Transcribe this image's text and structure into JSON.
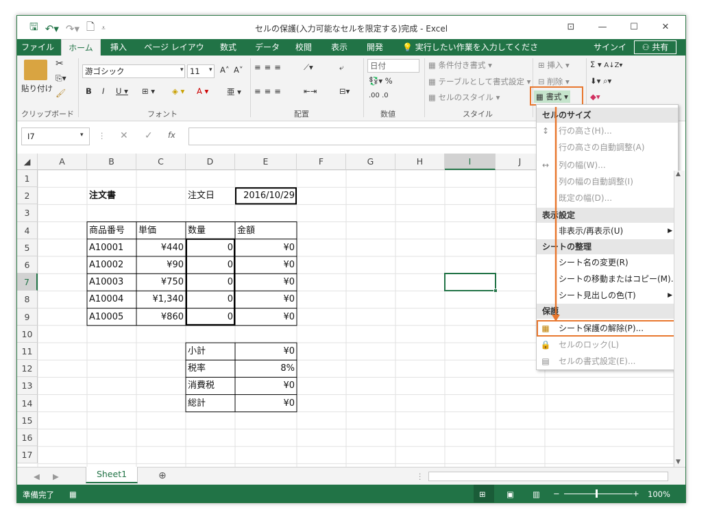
{
  "window": {
    "title": "セルの保護(入力可能なセルを限定する)完成 - Excel"
  },
  "quick_access": {
    "save_icon": "save-icon",
    "undo_icon": "undo-icon",
    "redo_icon": "redo-icon",
    "preview_icon": "print-preview-icon"
  },
  "tabs": [
    "ファイル",
    "ホーム",
    "挿入",
    "ページ レイアウト",
    "数式",
    "データ",
    "校閲",
    "表示",
    "開発"
  ],
  "tell_me": "実行したい作業を入力してください...",
  "signin": "サインイン",
  "share": "共有",
  "ribbon": {
    "clipboard": {
      "paste": "貼り付け",
      "label": "クリップボード"
    },
    "font": {
      "name": "游ゴシック",
      "size": "11",
      "label": "フォント"
    },
    "alignment": {
      "label": "配置"
    },
    "number": {
      "format": "日付",
      "label": "数値"
    },
    "styles": {
      "conditional": "条件付き書式",
      "table": "テーブルとして書式設定",
      "cell_styles": "セルのスタイル",
      "label": "スタイル"
    },
    "cells": {
      "insert": "挿入",
      "delete": "削除",
      "format": "書式"
    }
  },
  "name_box": "I7",
  "columns": [
    "A",
    "B",
    "C",
    "D",
    "E",
    "F",
    "G",
    "H",
    "I",
    "J"
  ],
  "rows": [
    "1",
    "2",
    "3",
    "4",
    "5",
    "6",
    "7",
    "8",
    "9",
    "10",
    "11",
    "12",
    "13",
    "14",
    "15",
    "16",
    "17"
  ],
  "sheet": {
    "title": "注文書",
    "order_date_label": "注文日",
    "order_date": "2016/10/29",
    "headers": {
      "product": "商品番号",
      "price": "単価",
      "qty": "数量",
      "amount": "金額"
    },
    "items": [
      {
        "product": "A10001",
        "price": "¥440",
        "qty": "0",
        "amount": "¥0"
      },
      {
        "product": "A10002",
        "price": "¥90",
        "qty": "0",
        "amount": "¥0"
      },
      {
        "product": "A10003",
        "price": "¥750",
        "qty": "0",
        "amount": "¥0"
      },
      {
        "product": "A10004",
        "price": "¥1,340",
        "qty": "0",
        "amount": "¥0"
      },
      {
        "product": "A10005",
        "price": "¥860",
        "qty": "0",
        "amount": "¥0"
      }
    ],
    "summary": [
      {
        "label": "小計",
        "value": "¥0"
      },
      {
        "label": "税率",
        "value": "8%"
      },
      {
        "label": "消費税",
        "value": "¥0"
      },
      {
        "label": "総計",
        "value": "¥0"
      }
    ]
  },
  "menu": {
    "section_size": "セルのサイズ",
    "row_height": "行の高さ(H)...",
    "row_autofit": "行の高さの自動調整(A)",
    "col_width": "列の幅(W)...",
    "col_autofit": "列の幅の自動調整(I)",
    "default_width": "既定の幅(D)...",
    "section_visibility": "表示設定",
    "hide_unhide": "非表示/再表示(U)",
    "section_organize": "シートの整理",
    "rename": "シート名の変更(R)",
    "move_copy": "シートの移動またはコピー(M)...",
    "tab_color": "シート見出しの色(T)",
    "section_protect": "保護",
    "unprotect": "シート保護の解除(P)...",
    "lock_cell": "セルのロック(L)",
    "format_cells": "セルの書式設定(E)..."
  },
  "sheet_tab": "Sheet1",
  "status": {
    "ready": "準備完了",
    "zoom": "100%"
  },
  "accent": "#217346",
  "highlight": "#e8772e"
}
